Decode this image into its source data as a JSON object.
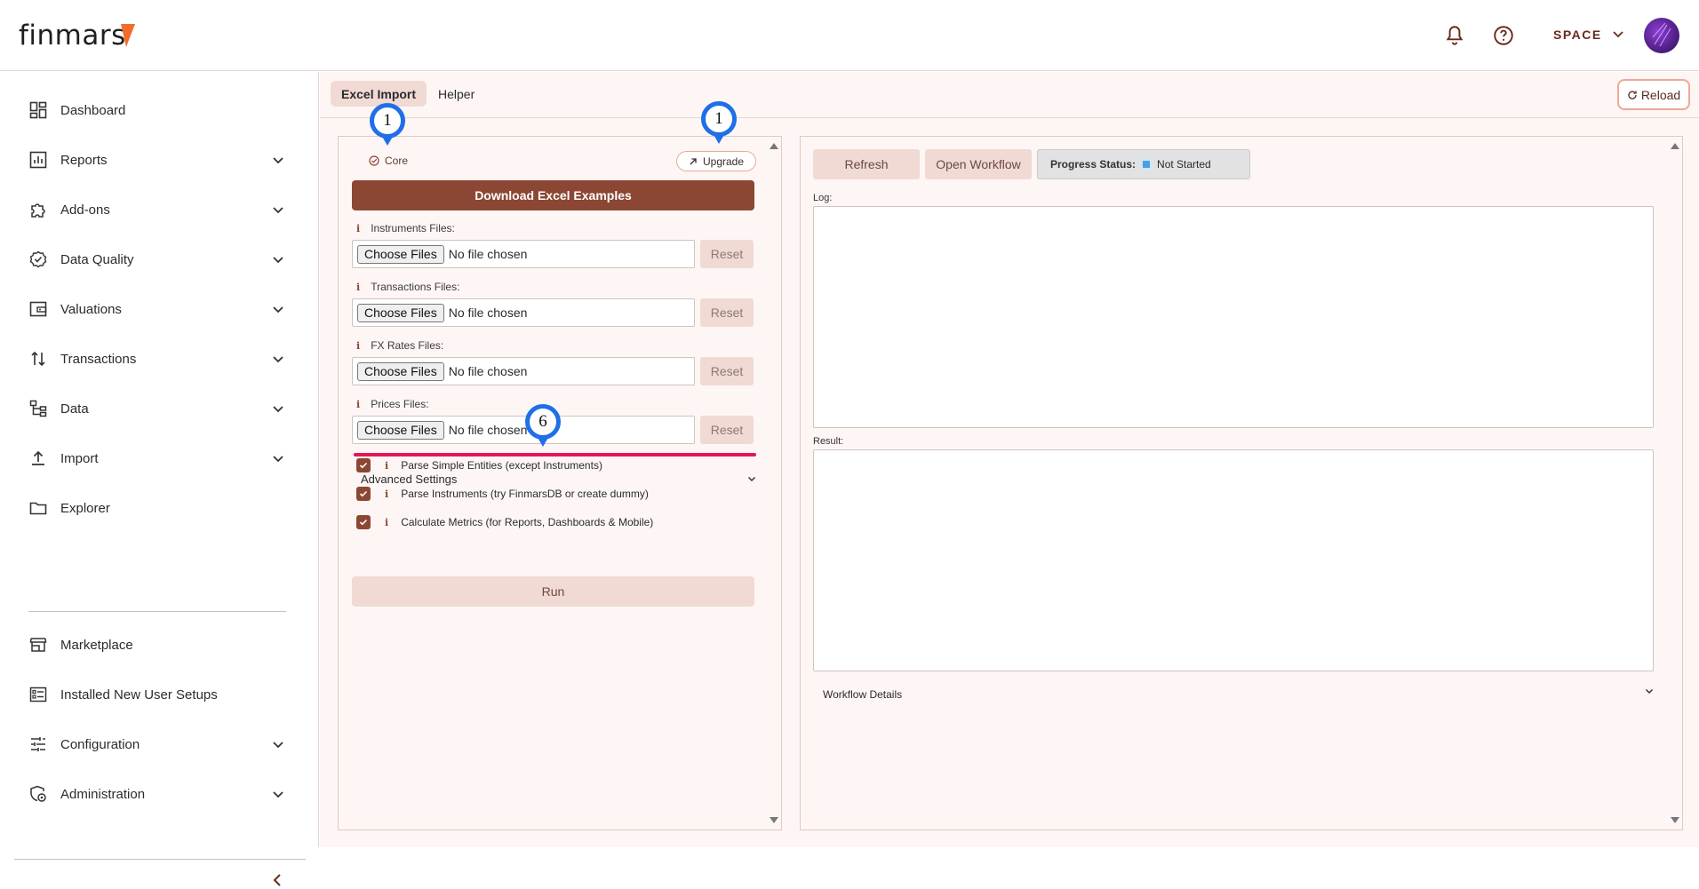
{
  "header": {
    "logo_text": "finmars",
    "space_label": "SPACE"
  },
  "sidebar": {
    "items": [
      {
        "label": "Dashboard",
        "icon": "dashboard-icon",
        "has_chevron": false
      },
      {
        "label": "Reports",
        "icon": "reports-icon",
        "has_chevron": true
      },
      {
        "label": "Add-ons",
        "icon": "puzzle-icon",
        "has_chevron": true
      },
      {
        "label": "Data Quality",
        "icon": "badge-check-icon",
        "has_chevron": true
      },
      {
        "label": "Valuations",
        "icon": "wallet-icon",
        "has_chevron": true
      },
      {
        "label": "Transactions",
        "icon": "swap-vertical-icon",
        "has_chevron": true
      },
      {
        "label": "Data",
        "icon": "tree-icon",
        "has_chevron": true
      },
      {
        "label": "Import",
        "icon": "upload-icon",
        "has_chevron": true
      },
      {
        "label": "Explorer",
        "icon": "folder-icon",
        "has_chevron": false
      },
      {
        "label": "Marketplace",
        "icon": "store-icon",
        "has_chevron": false
      },
      {
        "label": "Installed New User Setups",
        "icon": "list-box-icon",
        "has_chevron": false
      },
      {
        "label": "Configuration",
        "icon": "sliders-icon",
        "has_chevron": true
      },
      {
        "label": "Administration",
        "icon": "admin-icon",
        "has_chevron": true
      }
    ]
  },
  "tabs": [
    {
      "label": "Excel Import",
      "active": true
    },
    {
      "label": "Helper",
      "active": false
    }
  ],
  "reload_label": "Reload",
  "left_panel": {
    "core_label": "Core",
    "upgrade_label": "Upgrade",
    "download_label": "Download Excel Examples",
    "info_glyph": "i",
    "file_groups": [
      {
        "label": "Instruments Files:",
        "choose": "Choose Files",
        "status": "No file chosen",
        "reset": "Reset"
      },
      {
        "label": "Transactions Files:",
        "choose": "Choose Files",
        "status": "No file chosen",
        "reset": "Reset"
      },
      {
        "label": "FX Rates Files:",
        "choose": "Choose Files",
        "status": "No file chosen",
        "reset": "Reset"
      },
      {
        "label": "Prices Files:",
        "choose": "Choose Files",
        "status": "No file chosen",
        "reset": "Reset"
      }
    ],
    "checkboxes": [
      {
        "label": "Parse Simple Entities (except Instruments)",
        "checked": true
      },
      {
        "label": "Parse Instruments (try FinmarsDB or create dummy)",
        "checked": true
      },
      {
        "label": "Calculate Metrics (for Reports, Dashboards & Mobile)",
        "checked": true
      }
    ],
    "advanced_label": "Advanced Settings",
    "run_label": "Run"
  },
  "right_panel": {
    "refresh_label": "Refresh",
    "open_workflow_label": "Open Workflow",
    "progress_label": "Progress Status:",
    "progress_value": "Not Started",
    "log_label": "Log:",
    "result_label": "Result:",
    "workflow_details_label": "Workflow Details"
  },
  "markers": [
    {
      "number": "1"
    },
    {
      "number": "1"
    },
    {
      "number": "6"
    }
  ],
  "colors": {
    "accent": "#8b4733",
    "highlight_line": "#e2175a",
    "marker": "#1f6fe8",
    "soft_button": "#f1d9d4"
  }
}
